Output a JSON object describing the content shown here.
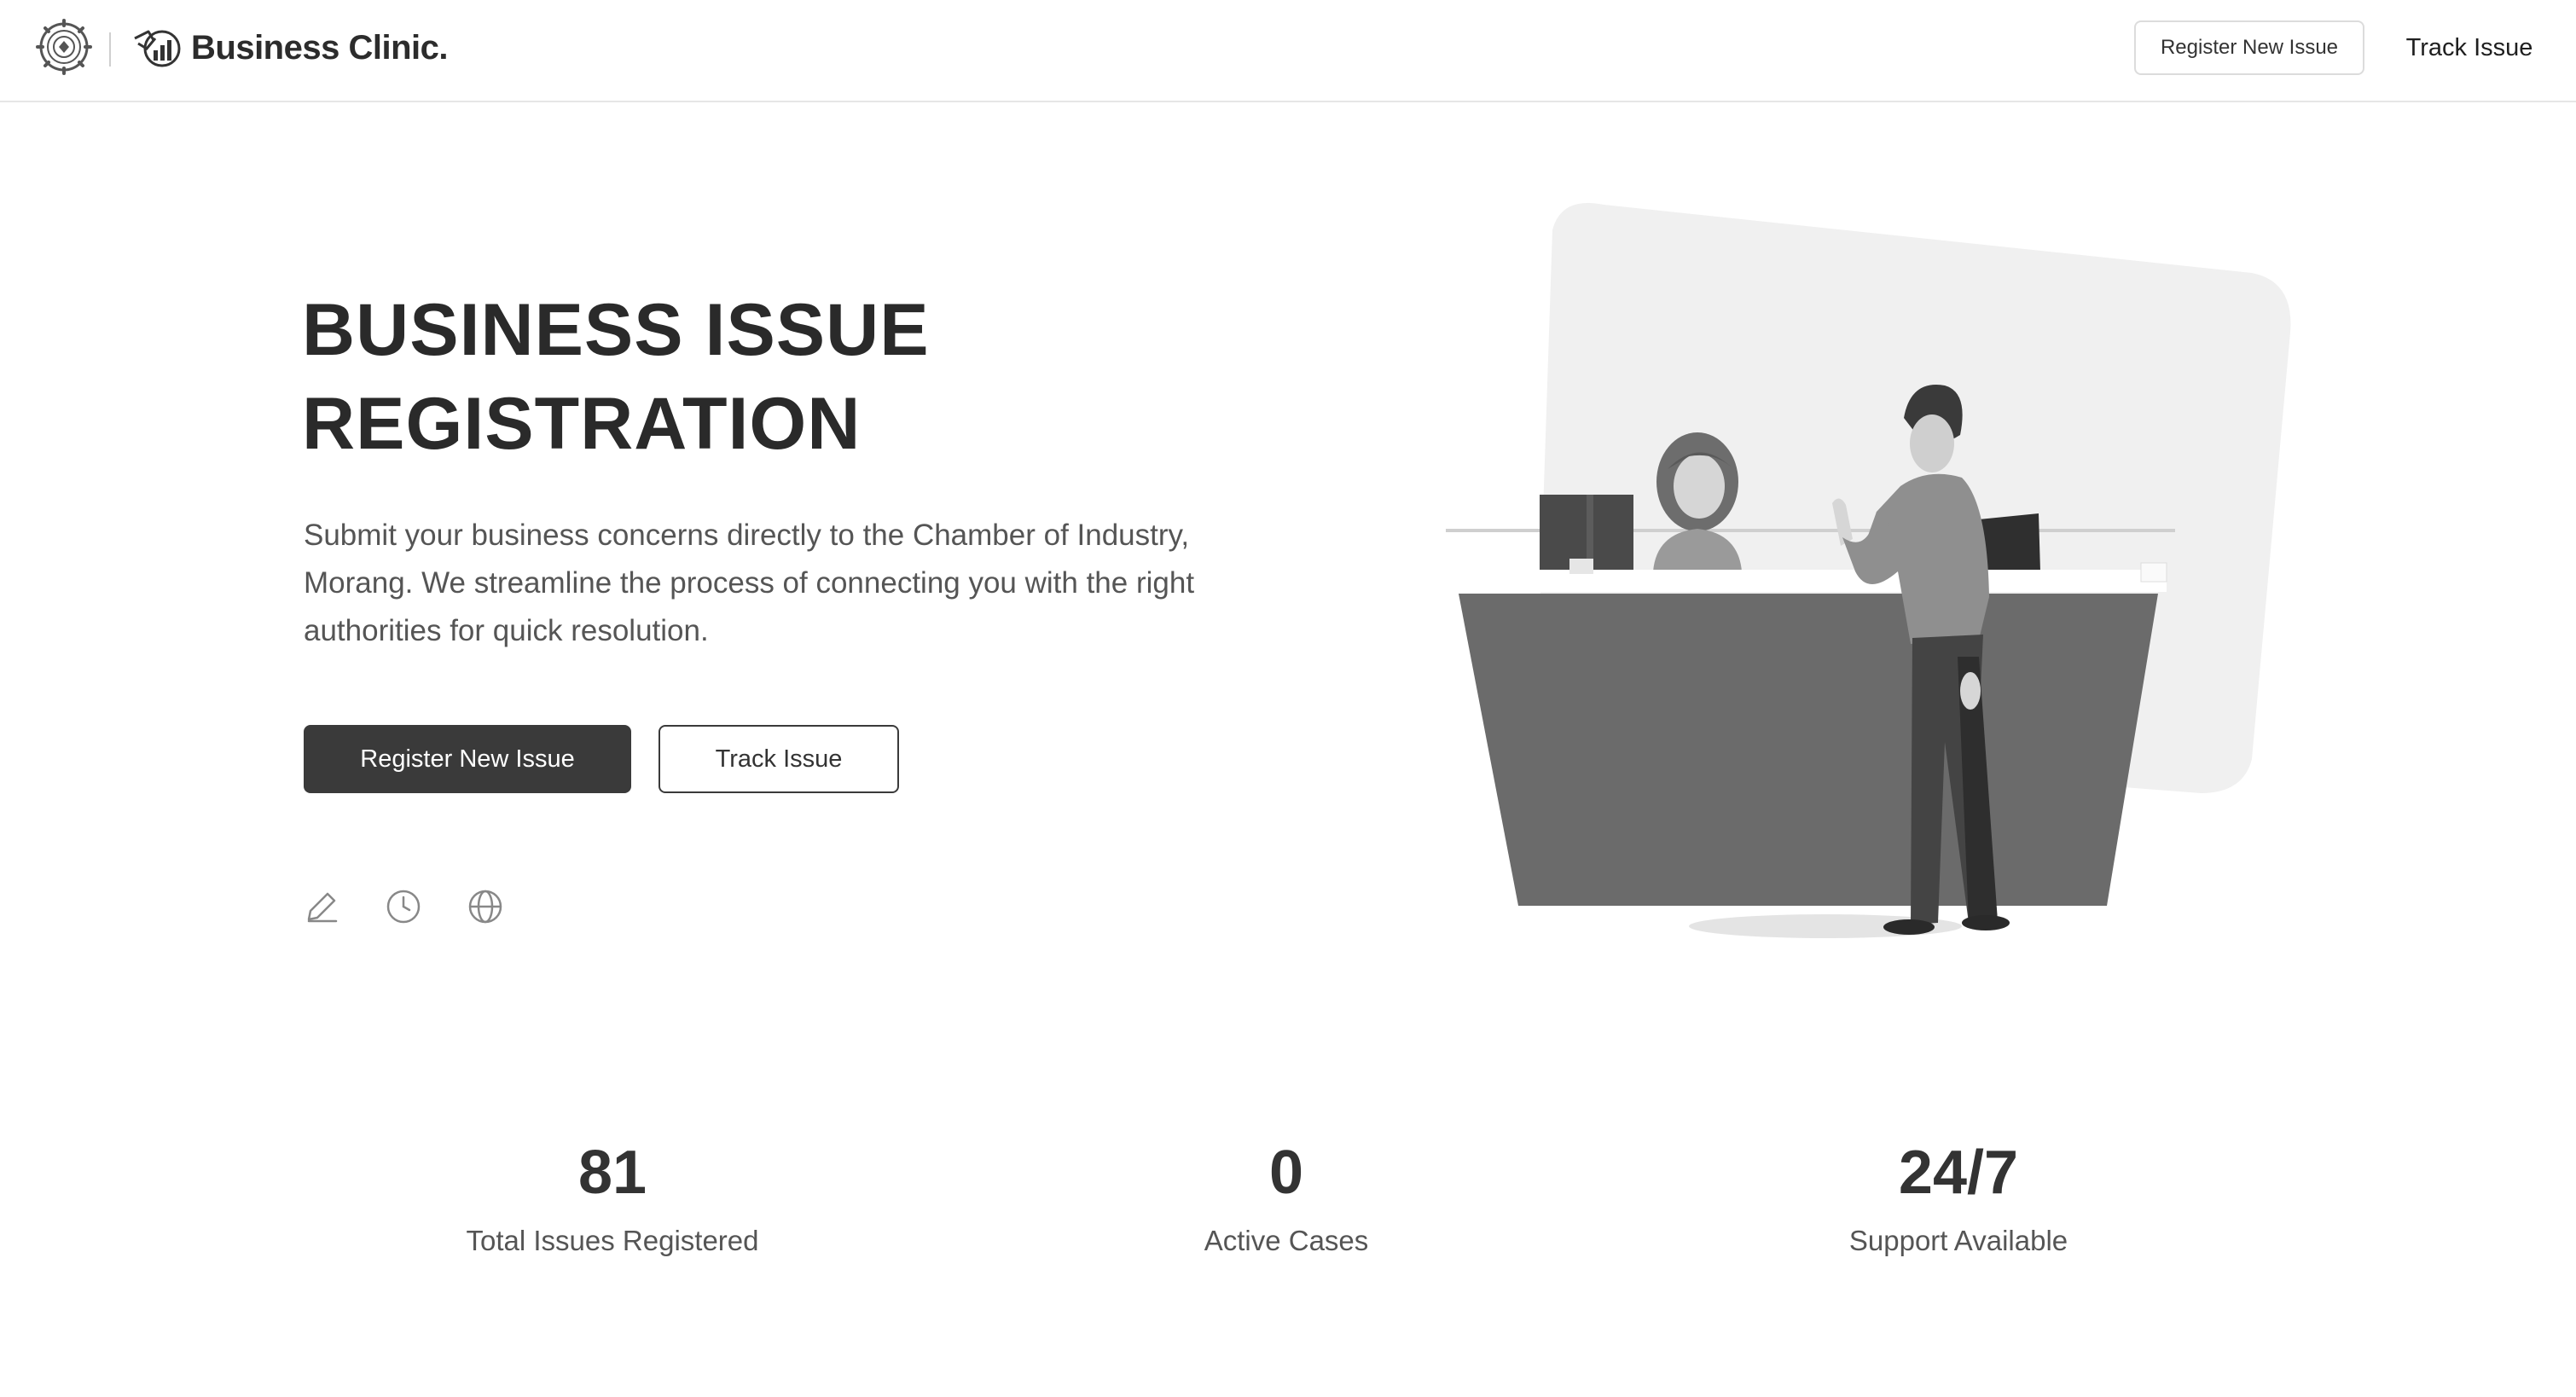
{
  "header": {
    "brand_name": "Business Clinic.",
    "nav": {
      "register_label": "Register New Issue",
      "track_label": "Track Issue"
    }
  },
  "hero": {
    "title_line1": "BUSINESS ISSUE",
    "title_line2": "REGISTRATION",
    "description": "Submit your business concerns directly to the Chamber of Industry, Morang. We streamline the process of connecting you with the right authorities for quick resolution.",
    "primary_button": "Register New Issue",
    "secondary_button": "Track Issue",
    "feature_icons": [
      "pencil-icon",
      "clock-icon",
      "globe-icon"
    ]
  },
  "stats": [
    {
      "value": "81",
      "label": "Total Issues Registered"
    },
    {
      "value": "0",
      "label": "Active Cases"
    },
    {
      "value": "24/7",
      "label": "Support Available"
    }
  ],
  "colors": {
    "primary_button": "#3a3a3a",
    "text_dark": "#2a2a2a",
    "text_muted": "#555555",
    "border": "#e6e6e6"
  }
}
